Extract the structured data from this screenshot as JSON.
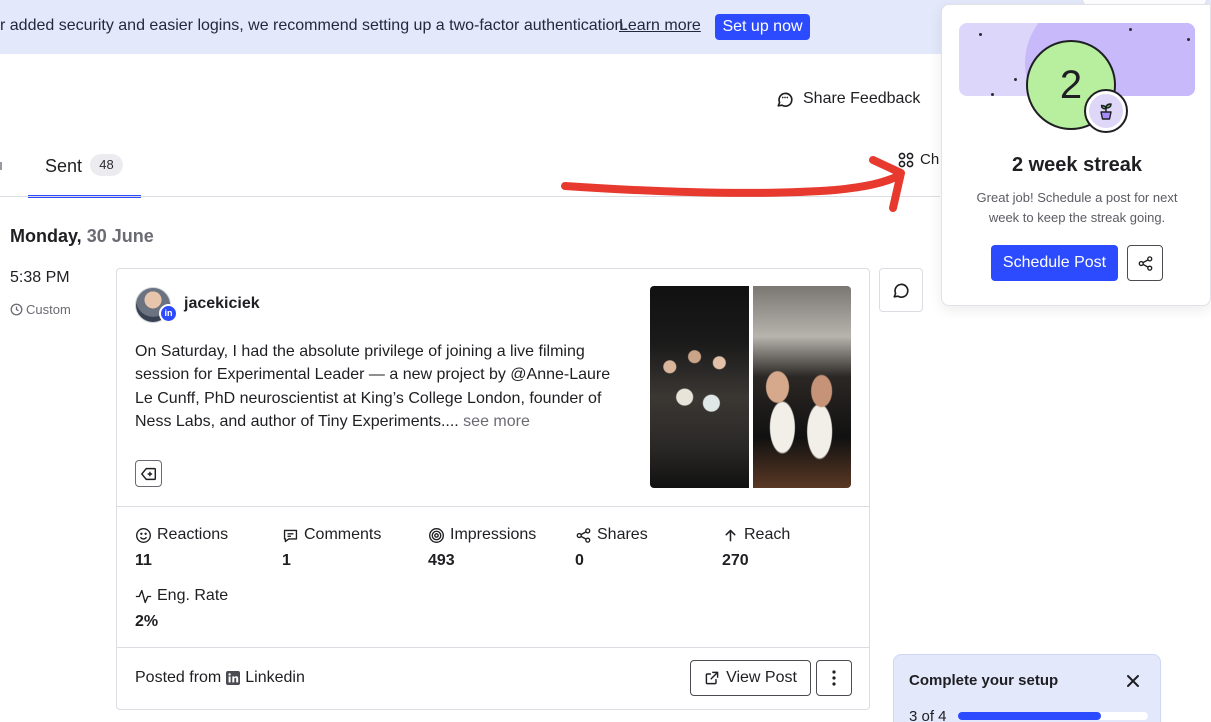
{
  "banner": {
    "text": "r added security and easier logins, we recommend setting up a two-factor authentication.",
    "link": "Learn more",
    "button": "Set up now"
  },
  "header": {
    "feedback_label": "Share Feedback",
    "feedback_icon": "chat-bubble-icon"
  },
  "tabs": {
    "sent_label": "Sent",
    "sent_count": "48",
    "channels_label": "Ch"
  },
  "day": {
    "weekday": "Monday,",
    "date": "30 June"
  },
  "post": {
    "time": "5:38 PM",
    "schedule_type": "Custom",
    "author": "jacekiciek",
    "text": "On Saturday, I had the absolute privilege of joining a live filming session for Experimental Leader — a new project by @Anne-Laure Le Cunff, PhD neuroscientist at King’s College London, founder of Ness Labs, and author of Tiny Experiments....",
    "see_more": "see more",
    "metrics": [
      {
        "label": "Reactions",
        "value": "11",
        "icon": "smiley-icon"
      },
      {
        "label": "Comments",
        "value": "1",
        "icon": "comment-icon"
      },
      {
        "label": "Impressions",
        "value": "493",
        "icon": "target-icon"
      },
      {
        "label": "Shares",
        "value": "0",
        "icon": "share-icon"
      },
      {
        "label": "Reach",
        "value": "270",
        "icon": "arrow-up-icon"
      },
      {
        "label": "Eng. Rate",
        "value": "2%",
        "icon": "activity-icon"
      }
    ],
    "footer_prefix": "Posted from",
    "footer_network": "Linkedin",
    "view_post": "View Post"
  },
  "streak": {
    "number": "2",
    "title": "2 week streak",
    "description": "Great job! Schedule a post for next week to keep the streak going.",
    "schedule_button": "Schedule Post"
  },
  "setup": {
    "title": "Complete your setup",
    "progress_label": "3 of 4",
    "progress_fraction": 0.75
  },
  "colors": {
    "accent": "#2c4bff",
    "banner_bg": "#e3e8fb",
    "streak_green": "#b7ef9f",
    "annotation_red": "#e8392f"
  }
}
